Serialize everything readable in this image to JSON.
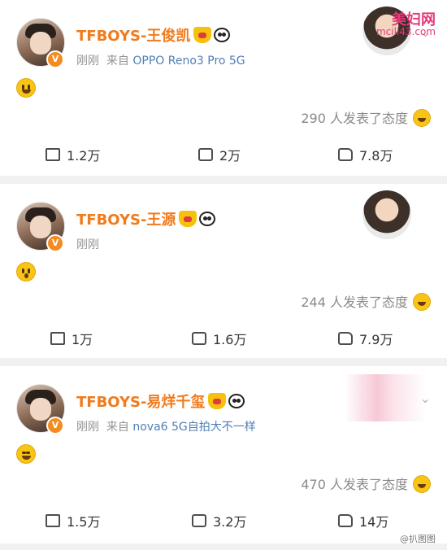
{
  "watermark": {
    "site": "美妇网",
    "url": "mcili43.com"
  },
  "bottom_watermark": "@扒图图",
  "posts": [
    {
      "name": "TFBOYS-王俊凯",
      "time": "刚刚",
      "source_prefix": "来自",
      "source": "OPPO Reno3 Pro 5G",
      "reaction_text": "290 人发表了态度",
      "repost": "1.2万",
      "comment": "2万",
      "like": "7.8万"
    },
    {
      "name": "TFBOYS-王源",
      "time": "刚刚",
      "source_prefix": "",
      "source": "",
      "reaction_text": "244 人发表了态度",
      "repost": "1万",
      "comment": "1.6万",
      "like": "7.9万"
    },
    {
      "name": "TFBOYS-易烊千玺",
      "time": "刚刚",
      "source_prefix": "来自",
      "source": "nova6 5G自拍大不一样",
      "reaction_text": "470 人发表了态度",
      "repost": "1.5万",
      "comment": "3.2万",
      "like": "14万"
    }
  ],
  "icons": {
    "verified": "verified-badge-icon",
    "crown": "crown-icon",
    "panda": "panda-icon",
    "repost": "repost-icon",
    "comment": "comment-icon",
    "like": "thumbs-up-icon",
    "chevron": "chevron-down-icon"
  }
}
